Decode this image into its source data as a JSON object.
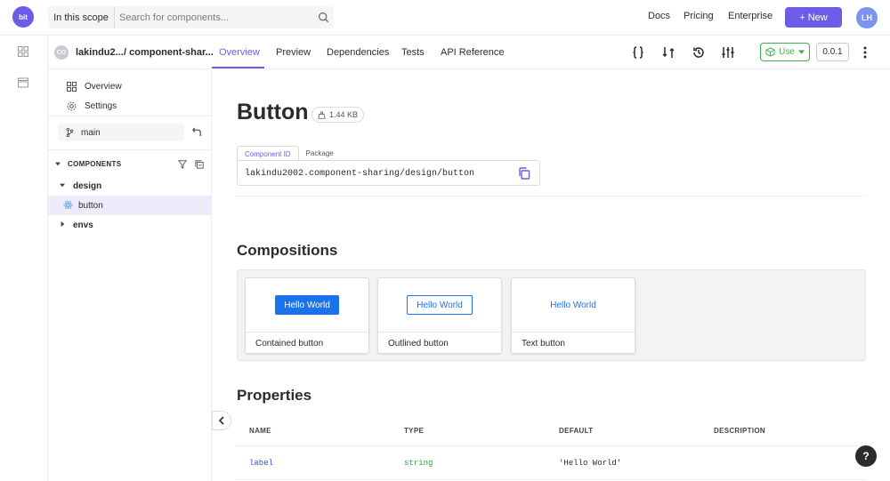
{
  "topbar": {
    "logo": "bit",
    "scope_label": "In this scope",
    "search_placeholder": "Search for components...",
    "links": [
      "Docs",
      "Pricing",
      "Enterprise"
    ],
    "new_button": "+ New",
    "user_initials": "LH"
  },
  "component_header": {
    "avatar": "CO",
    "owner": "lakindu2...",
    "scope": "/ component-shar...",
    "tabs": [
      "Overview",
      "Preview",
      "Dependencies",
      "Tests",
      "API Reference"
    ],
    "active_tab": "Overview",
    "tool_icons": [
      "code-braces-icon",
      "compare-icon",
      "history-icon",
      "settings-sliders-icon"
    ],
    "use_button": "Use",
    "version": "0.0.1"
  },
  "sidebar": {
    "nav": [
      {
        "label": "Overview",
        "icon": "grid-icon"
      },
      {
        "label": "Settings",
        "icon": "gear-icon"
      }
    ],
    "branch": "main",
    "components_heading": "COMPONENTS",
    "tree": [
      {
        "label": "design",
        "type": "folder",
        "expanded": true
      },
      {
        "label": "button",
        "type": "component",
        "selected": true
      },
      {
        "label": "envs",
        "type": "folder",
        "expanded": false
      }
    ]
  },
  "main": {
    "title": "Button",
    "size": "1.44 KB",
    "id_tabs": [
      "Component ID",
      "Package"
    ],
    "component_id": "lakindu2002.component-sharing/design/button",
    "compositions_heading": "Compositions",
    "compositions": [
      {
        "demo_label": "Hello World",
        "caption": "Contained button",
        "variant": "contained"
      },
      {
        "demo_label": "Hello World",
        "caption": "Outlined button",
        "variant": "outlined"
      },
      {
        "demo_label": "Hello World",
        "caption": "Text button",
        "variant": "text"
      }
    ],
    "properties_heading": "Properties",
    "properties_columns": [
      "NAME",
      "TYPE",
      "DEFAULT",
      "DESCRIPTION"
    ],
    "properties_rows": [
      {
        "name": "label",
        "type": "string",
        "default": "'Hello World'",
        "description": ""
      }
    ]
  },
  "help_button": "?",
  "colors": {
    "accent": "#6c5ce7",
    "use_green": "#37b24d",
    "demo_blue": "#1a73e8",
    "prop_name": "#3b4fc4",
    "prop_type": "#2f9e44"
  }
}
